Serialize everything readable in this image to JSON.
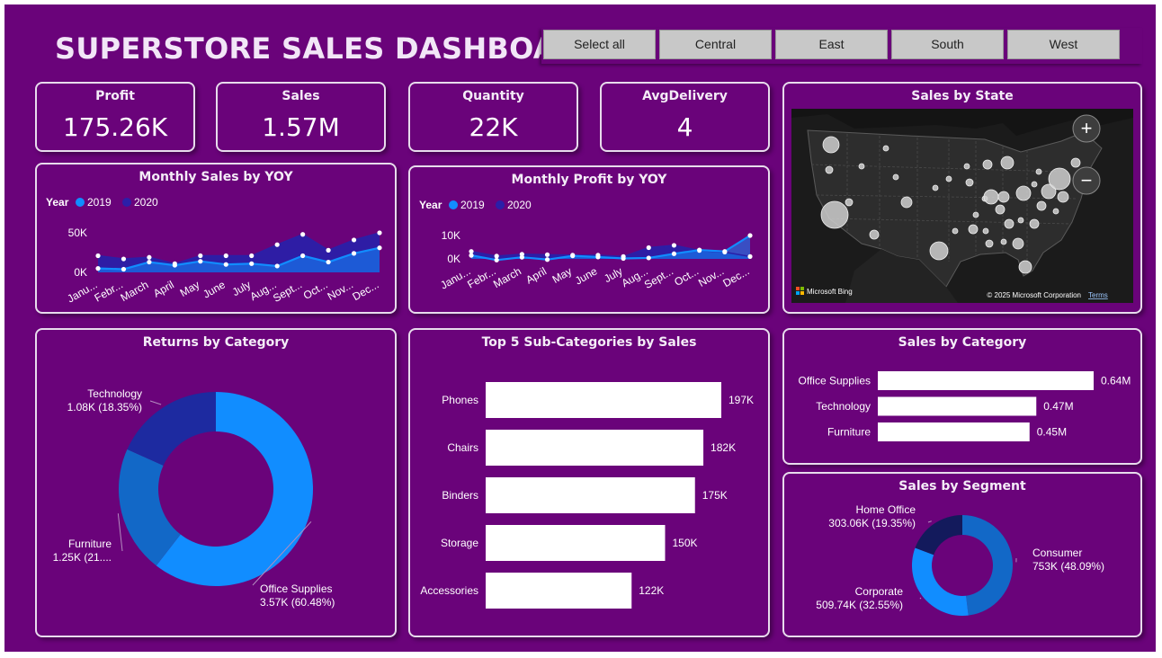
{
  "header": {
    "title": "SUPERSTORE SALES DASHBOARD"
  },
  "slicer": {
    "items": [
      "Select all",
      "Central",
      "East",
      "South",
      "West"
    ]
  },
  "kpis": [
    {
      "label": "Profit",
      "value": "175.26K"
    },
    {
      "label": "Sales",
      "value": "1.57M"
    },
    {
      "label": "Quantity",
      "value": "22K"
    },
    {
      "label": "AvgDelivery",
      "value": "4"
    }
  ],
  "map": {
    "title": "Sales by State",
    "zoom_in": "+",
    "zoom_out": "−",
    "attribution": "Microsoft Bing",
    "copyright": "© 2025 Microsoft Corporation",
    "terms": "Terms"
  },
  "colors": {
    "background": "#6a037a",
    "series_2019": "#118dff",
    "series_2020": "#2b1fa8",
    "bar": "#ffffff",
    "donut": [
      "#118dff",
      "#1268c7",
      "#1d2aa0"
    ]
  },
  "chart_data": [
    {
      "id": "monthly-sales",
      "type": "area",
      "title": "Monthly Sales by YOY",
      "legend_title": "Year",
      "categories": [
        "January",
        "February",
        "March",
        "April",
        "May",
        "June",
        "July",
        "August",
        "September",
        "October",
        "November",
        "December"
      ],
      "tick_labels": [
        "Janu...",
        "Febr...",
        "March",
        "April",
        "May",
        "June",
        "July",
        "Aug...",
        "Sept...",
        "Oct...",
        "Nov...",
        "Dec..."
      ],
      "y_ticks": [
        "50K",
        "0K"
      ],
      "ylim": [
        0,
        50000
      ],
      "series": [
        {
          "name": "2019",
          "values": [
            5000,
            4000,
            13000,
            9000,
            14000,
            10000,
            11000,
            8000,
            21000,
            13000,
            24000,
            31000
          ]
        },
        {
          "name": "2020",
          "values": [
            21000,
            17000,
            19000,
            11000,
            21000,
            21000,
            21000,
            35000,
            48000,
            28000,
            41000,
            50000
          ]
        }
      ]
    },
    {
      "id": "monthly-profit",
      "type": "area",
      "title": "Monthly Profit by YOY",
      "legend_title": "Year",
      "categories": [
        "January",
        "February",
        "March",
        "April",
        "May",
        "June",
        "July",
        "August",
        "September",
        "October",
        "November",
        "December"
      ],
      "tick_labels": [
        "Janu...",
        "Febr...",
        "March",
        "April",
        "May",
        "June",
        "July",
        "Aug...",
        "Sept...",
        "Oct...",
        "Nov...",
        "Dec..."
      ],
      "y_ticks": [
        "10K",
        "0K"
      ],
      "ylim": [
        0,
        10000
      ],
      "series": [
        {
          "name": "2019",
          "values": [
            1500,
            -500,
            700,
            -300,
            1300,
            800,
            200,
            400,
            2200,
            3800,
            3200,
            10000
          ]
        },
        {
          "name": "2020",
          "values": [
            3200,
            1200,
            2000,
            1800,
            1600,
            1600,
            1000,
            4800,
            5800,
            3600,
            2900,
            1000
          ]
        }
      ]
    },
    {
      "id": "returns-by-category",
      "type": "pie",
      "title": "Returns by Category",
      "slices": [
        {
          "name": "Office Supplies",
          "value": 3570,
          "label": "3.57K (60.48%)"
        },
        {
          "name": "Furniture",
          "value": 1250,
          "label": "1.25K (21...."
        },
        {
          "name": "Technology",
          "value": 1080,
          "label": "1.08K (18.35%)"
        }
      ]
    },
    {
      "id": "top5-subcategories",
      "type": "bar",
      "title": "Top 5 Sub-Categories by Sales",
      "categories": [
        "Phones",
        "Chairs",
        "Binders",
        "Storage",
        "Accessories"
      ],
      "values": [
        197000,
        182000,
        175000,
        150000,
        122000
      ],
      "labels": [
        "197K",
        "182K",
        "175K",
        "150K",
        "122K"
      ],
      "xlim": [
        0,
        197000
      ]
    },
    {
      "id": "sales-by-category",
      "type": "bar",
      "title": "Sales by Category",
      "categories": [
        "Office Supplies",
        "Technology",
        "Furniture"
      ],
      "values": [
        640000,
        470000,
        450000
      ],
      "labels": [
        "0.64M",
        "0.47M",
        "0.45M"
      ],
      "xlim": [
        0,
        640000
      ]
    },
    {
      "id": "sales-by-segment",
      "type": "pie",
      "title": "Sales by Segment",
      "slices": [
        {
          "name": "Consumer",
          "value": 753000,
          "label": "753K (48.09%)"
        },
        {
          "name": "Corporate",
          "value": 509740,
          "label": "509.74K (32.55%)"
        },
        {
          "name": "Home Office",
          "value": 303060,
          "label": "303.06K (19.35%)"
        }
      ]
    }
  ]
}
